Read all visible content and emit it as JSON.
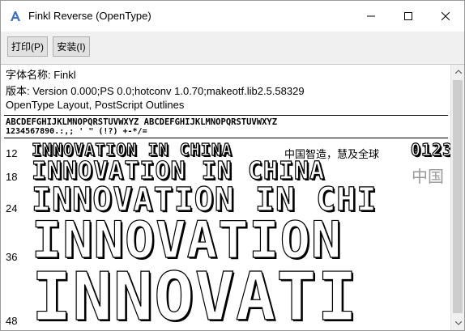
{
  "window": {
    "title": "Finkl Reverse (OpenType)",
    "controls": [
      "minimize-icon",
      "maximize-icon",
      "close-icon"
    ]
  },
  "toolbar": {
    "print_label": "打印(P)",
    "install_label": "安装(I)"
  },
  "info": {
    "font_name": "字体名称: Finkl",
    "version": "版本: Version 0.000;PS 0.0;hotconv 1.0.70;makeotf.lib2.5.58329",
    "outline": "OpenType Layout, PostScript Outlines"
  },
  "charset": {
    "line1": "ABCDEFGHIJKLMNOPQRSTUVWXYZ ABCDEFGHIJKLMNOPQRSTUVWXYZ",
    "line2": "1234567890.:,; ' \" (!?) +-*/="
  },
  "samples": [
    {
      "size_label": "12",
      "text": "INNOVATION IN CHINA",
      "cjk": "中国智造，慧及全球",
      "tail": "0123"
    },
    {
      "size_label": "18",
      "text": "INNOVATION IN CHINA",
      "cjk": "中国"
    },
    {
      "size_label": "24",
      "text": "INNOVATION IN CHI"
    },
    {
      "size_label": "36",
      "text": "INNOVATION"
    },
    {
      "size_label": "48",
      "text": "INNOVATI"
    }
  ]
}
